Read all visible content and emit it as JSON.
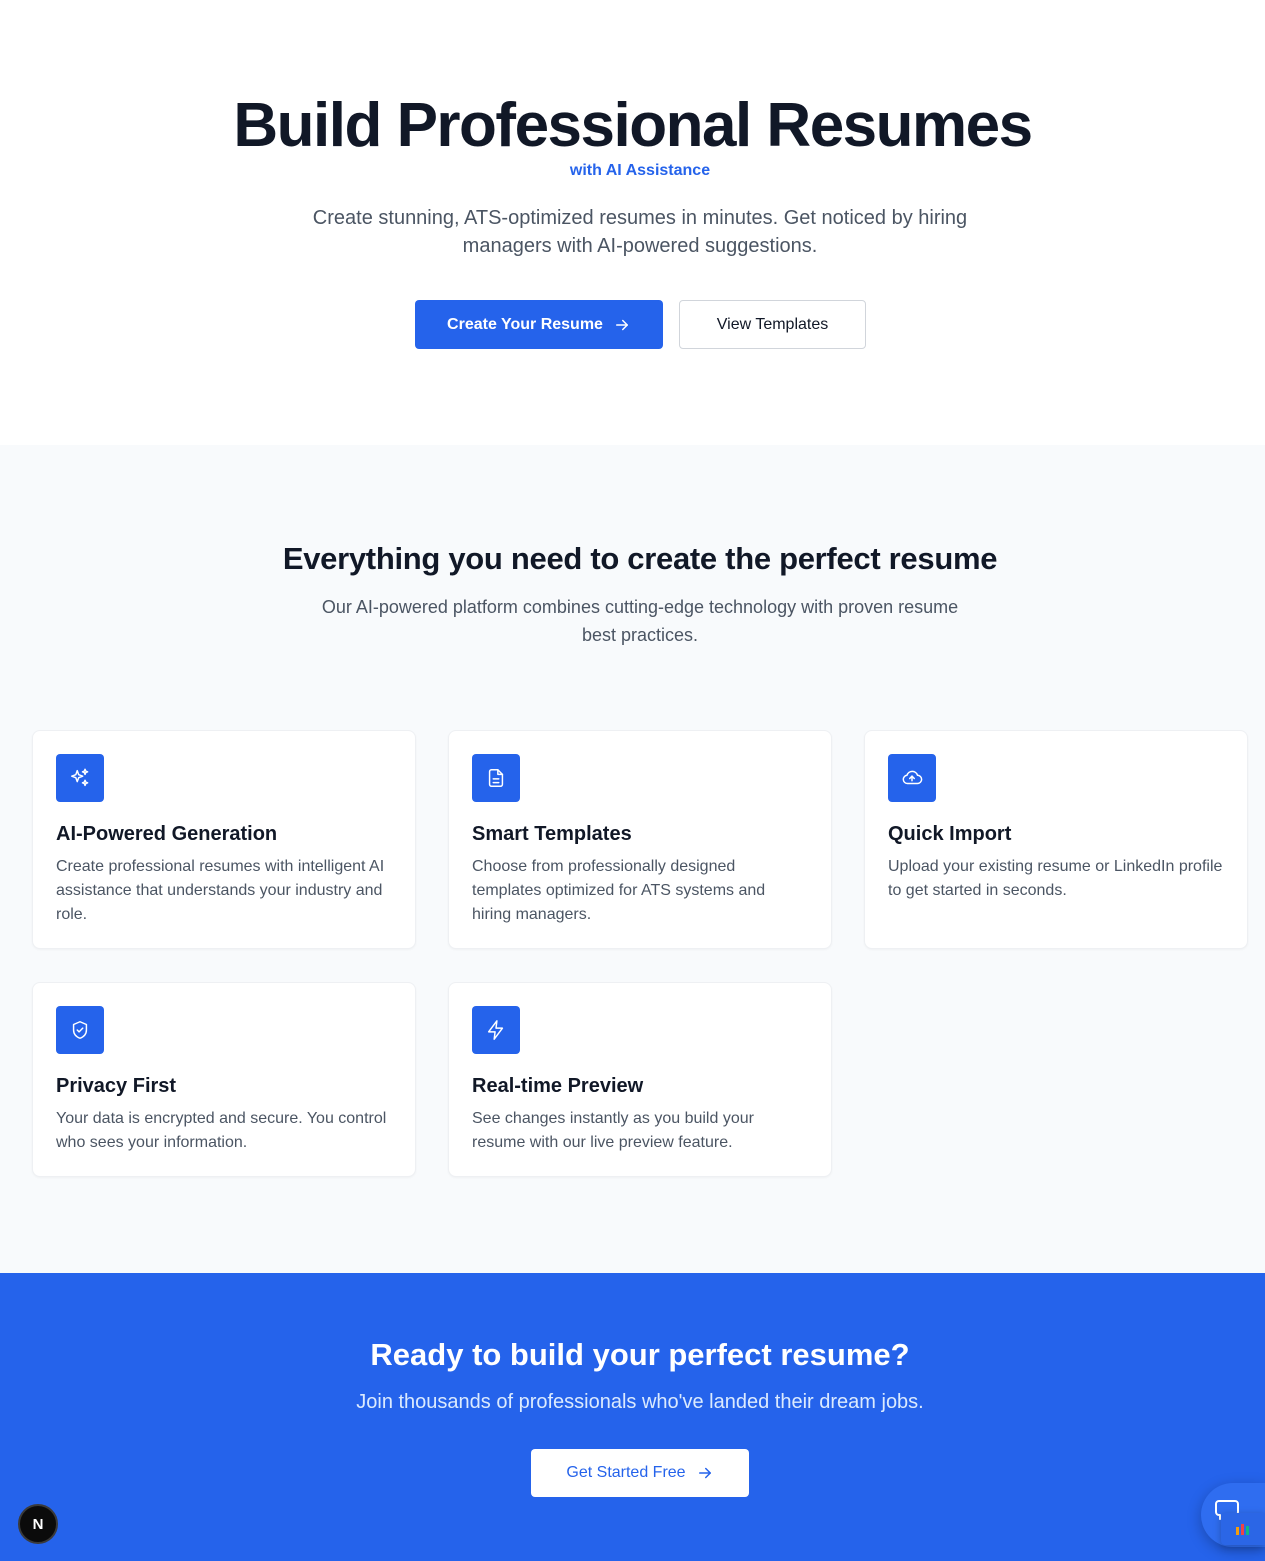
{
  "hero": {
    "title": "Build Professional Resumes",
    "subtitle": "with AI Assistance",
    "description": "Create stunning, ATS-optimized resumes in minutes. Get noticed by hiring managers with AI-powered suggestions.",
    "primary_button": "Create Your Resume",
    "secondary_button": "View Templates"
  },
  "features": {
    "title": "Everything you need to create the perfect resume",
    "description": "Our AI-powered platform combines cutting-edge technology with proven resume best practices.",
    "items": [
      {
        "icon": "sparkles-icon",
        "title": "AI-Powered Generation",
        "text": "Create professional resumes with intelligent AI assistance that understands your industry and role."
      },
      {
        "icon": "document-icon",
        "title": "Smart Templates",
        "text": "Choose from professionally designed templates optimized for ATS systems and hiring managers."
      },
      {
        "icon": "cloud-upload-icon",
        "title": "Quick Import",
        "text": "Upload your existing resume or LinkedIn profile to get started in seconds."
      },
      {
        "icon": "shield-check-icon",
        "title": "Privacy First",
        "text": "Your data is encrypted and secure. You control who sees your information."
      },
      {
        "icon": "lightning-icon",
        "title": "Real-time Preview",
        "text": "See changes instantly as you build your resume with our live preview feature."
      }
    ]
  },
  "cta": {
    "title": "Ready to build your perfect resume?",
    "description": "Join thousands of professionals who've landed their dream jobs.",
    "button": "Get Started Free"
  },
  "badge": {
    "letter": "N"
  },
  "colors": {
    "primary": "#2563eb",
    "heading": "#111827",
    "body": "#4b5563",
    "section_bg": "#f8fafc"
  }
}
